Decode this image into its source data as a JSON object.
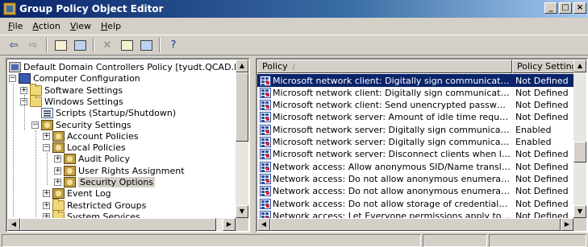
{
  "window": {
    "title": "Group Policy Object Editor"
  },
  "menu": {
    "items": [
      {
        "key": "F",
        "rest": "ile"
      },
      {
        "key": "A",
        "rest": "ction"
      },
      {
        "key": "V",
        "rest": "iew"
      },
      {
        "key": "H",
        "rest": "elp"
      }
    ]
  },
  "toolbar": {
    "buttons": [
      "back-icon",
      "forward-icon",
      "up-folder-icon",
      "show-hide-tree-icon",
      "delete-icon",
      "properties-icon",
      "export-list-icon",
      "help-icon"
    ]
  },
  "tree": {
    "nodes": [
      {
        "label": "Default Domain Controllers Policy [tyudt.QCAD.local] Policy",
        "icon": "policy-icon",
        "level": 0,
        "expander": ""
      },
      {
        "label": "Computer Configuration",
        "icon": "computer-icon",
        "level": 0,
        "expander": "−"
      },
      {
        "label": "Software Settings",
        "icon": "folder-icon",
        "level": 1,
        "expander": "+"
      },
      {
        "label": "Windows Settings",
        "icon": "folder-icon",
        "level": 1,
        "expander": "−"
      },
      {
        "label": "Scripts (Startup/Shutdown)",
        "icon": "scripts-icon",
        "level": 2,
        "expander": ""
      },
      {
        "label": "Security Settings",
        "icon": "security-icon",
        "level": 2,
        "expander": "−"
      },
      {
        "label": "Account Policies",
        "icon": "security-icon",
        "level": 3,
        "expander": "+"
      },
      {
        "label": "Local Policies",
        "icon": "security-icon",
        "level": 3,
        "expander": "−"
      },
      {
        "label": "Audit Policy",
        "icon": "security-icon",
        "level": 4,
        "expander": "+"
      },
      {
        "label": "User Rights Assignment",
        "icon": "security-icon",
        "level": 4,
        "expander": "+"
      },
      {
        "label": "Security Options",
        "icon": "security-icon",
        "level": 4,
        "expander": "+",
        "selected": true
      },
      {
        "label": "Event Log",
        "icon": "security-icon",
        "level": 3,
        "expander": "+"
      },
      {
        "label": "Restricted Groups",
        "icon": "folder-icon",
        "level": 3,
        "expander": "+"
      },
      {
        "label": "System Services",
        "icon": "folder-icon",
        "level": 3,
        "expander": "+"
      }
    ]
  },
  "list": {
    "columns": [
      "Policy",
      "Policy Setting"
    ],
    "sort_indicator": "/",
    "rows": [
      {
        "policy": "Microsoft network client: Digitally sign communications (always)",
        "setting": "Not Defined",
        "selected": true
      },
      {
        "policy": "Microsoft network client: Digitally sign communications (if server ...",
        "setting": "Not Defined"
      },
      {
        "policy": "Microsoft network client: Send unencrypted password to third-pa...",
        "setting": "Not Defined"
      },
      {
        "policy": "Microsoft network server: Amount of idle time required before su...",
        "setting": "Not Defined"
      },
      {
        "policy": "Microsoft network server: Digitally sign communications (always)",
        "setting": "Enabled"
      },
      {
        "policy": "Microsoft network server: Digitally sign communications (if client ...",
        "setting": "Enabled"
      },
      {
        "policy": "Microsoft network server: Disconnect clients when logon hours e...",
        "setting": "Not Defined"
      },
      {
        "policy": "Network access: Allow anonymous SID/Name translation",
        "setting": "Not Defined"
      },
      {
        "policy": "Network access: Do not allow anonymous enumeration of SAM a...",
        "setting": "Not Defined"
      },
      {
        "policy": "Network access: Do not allow anonymous enumeration of SAM a...",
        "setting": "Not Defined"
      },
      {
        "policy": "Network access: Do not allow storage of credentials or .NET Pas...",
        "setting": "Not Defined"
      },
      {
        "policy": "Network access: Let Everyone permissions apply to anonymous ...",
        "setting": "Not Defined"
      }
    ]
  },
  "colors": {
    "selection": "#0a246a",
    "titlebar_start": "#0a246a",
    "titlebar_end": "#a6caf0",
    "face": "#d4d0c8"
  }
}
